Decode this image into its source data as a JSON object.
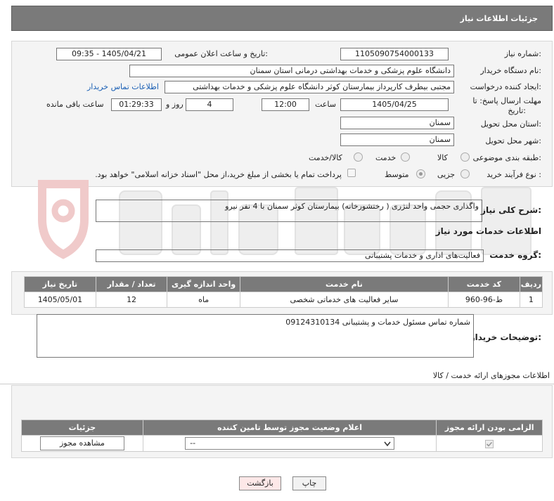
{
  "header": {
    "title": "جزئیات اطلاعات نیاز"
  },
  "form": {
    "need_number_label": "شماره نیاز:",
    "need_number": "1105090754000133",
    "announce_label": "تاریخ و ساعت اعلان عمومی:",
    "announce_value": "1405/04/21 - 09:35",
    "buyer_label": "نام دستگاه خریدار:",
    "buyer_value": "دانشگاه علوم پزشکی و خدمات بهداشتی  درمانی استان سمنان",
    "creator_label": "ایجاد کننده درخواست:",
    "creator_value": "مجتبی بیطرف کارپرداز بیمارستان کوثر دانشگاه علوم پزشکی و خدمات بهداشتی",
    "contact_link": "اطلاعات تماس خریدار",
    "deadline_label_1": "مهلت ارسال پاسخ: تا",
    "deadline_label_2": "تاریخ:",
    "deadline_date": "1405/04/25",
    "time_label": "ساعت",
    "deadline_time": "12:00",
    "days_value": "4",
    "days_label": "روز و",
    "remaining_time": "01:29:33",
    "remaining_label": "ساعت باقی مانده",
    "province_label": "استان محل تحویل:",
    "province_value": "سمنان",
    "city_label": "شهر محل تحویل:",
    "city_value": "سمنان",
    "category_label": "طبقه بندی موضوعی:",
    "category_options": [
      "کالا",
      "خدمت",
      "کالا/خدمت"
    ],
    "process_label": "نوع فرآیند خرید :",
    "process_options": [
      "جزیی",
      "متوسط"
    ],
    "payment_note": "پرداخت تمام یا بخشی از مبلغ خرید،از محل \"اسناد خزانه اسلامی\" خواهد بود."
  },
  "description": {
    "label": "شرح کلی نیاز:",
    "value": "واگذاری حجمی واحد لنژری ( رختشورخانه) بیمارستان کوثر سمنان با 4 نفر نیرو"
  },
  "services": {
    "title": "اطلاعات خدمات مورد نیاز",
    "group_label": "گروه خدمت:",
    "group_value": "فعالیت‌های اداری و خدمات پشتیبانی",
    "table": {
      "headers": [
        "ردیف",
        "کد خدمت",
        "نام خدمت",
        "واحد اندازه گیری",
        "تعداد / مقدار",
        "تاریخ نیاز"
      ],
      "rows": [
        [
          "1",
          "ط-96-960",
          "سایر فعالیت های خدماتی شخصی",
          "ماه",
          "12",
          "1405/05/01"
        ]
      ]
    }
  },
  "buyer_notes": {
    "label": "توضیحات خریدار:",
    "value": "شماره تماس مسئول خدمات و پشتیبانی 09124310134"
  },
  "permits": {
    "title": "اطلاعات مجوزهای ارائه خدمت / کالا",
    "headers": [
      "الزامی بودن ارائه مجوز",
      "اعلام وضعیت مجوز توسط تامین کننده",
      "جزئیات"
    ],
    "select_value": "--",
    "view_button": "مشاهده مجوز"
  },
  "footer": {
    "print_button": "چاپ",
    "back_button": "بازگشت"
  },
  "colors": {
    "header": "#7a7a7a",
    "link": "#1a5fb4",
    "back_button": "#fde8e8"
  }
}
